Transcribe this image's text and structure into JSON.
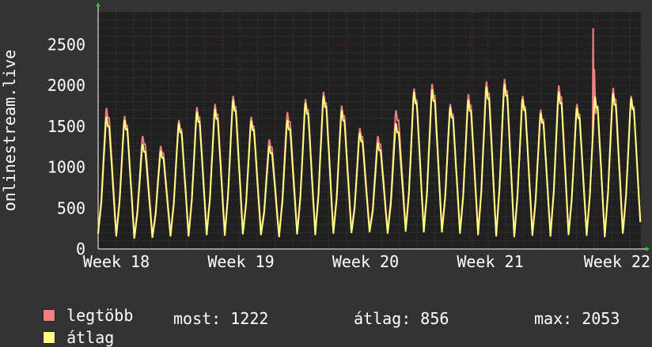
{
  "chart_data": {
    "type": "line",
    "ylabel": "onlinestream.live",
    "xtick_labels": [
      "Week 18",
      "Week 19",
      "Week 20",
      "Week 21",
      "Week 22"
    ],
    "ytick_labels": [
      "0",
      "500",
      "1000",
      "1500",
      "2000",
      "2500"
    ],
    "ylim": [
      0,
      2900
    ],
    "grid": true,
    "daily_peak_max": [
      1750,
      1650,
      1400,
      1280,
      1600,
      1760,
      1800,
      1900,
      1640,
      1360,
      1700,
      1860,
      1950,
      1780,
      1500,
      1400,
      1720,
      1990,
      2050,
      1800,
      1920,
      2080,
      2110,
      1900,
      1730,
      2030,
      1800,
      1910,
      2000,
      1900
    ],
    "daily_peak_avg": [
      1640,
      1600,
      1300,
      1220,
      1560,
      1700,
      1740,
      1850,
      1590,
      1280,
      1600,
      1810,
      1900,
      1720,
      1440,
      1320,
      1560,
      1950,
      1980,
      1760,
      1850,
      2010,
      2050,
      1860,
      1690,
      1950,
      1750,
      1890,
      1930,
      1870
    ],
    "daily_low": [
      220,
      180,
      150,
      160,
      180,
      180,
      200,
      190,
      210,
      200,
      170,
      210,
      200,
      220,
      230,
      240,
      220,
      250,
      240,
      240,
      220,
      200,
      180,
      170,
      190,
      180,
      200,
      190,
      170,
      220
    ],
    "spike_max": 2700,
    "series": [
      {
        "name": "legtöbb",
        "color": "#F08080"
      },
      {
        "name": "átlag",
        "color": "#FFFF80"
      }
    ]
  },
  "legend": {
    "max_label": "legtöbb",
    "avg_label": "átlag",
    "stat_now": "most: 1222",
    "stat_avg": "átlag: 856",
    "stat_max": "max: 2053"
  },
  "colors": {
    "background": "#333333",
    "plot_bg": "#202020",
    "max_color": "#F08080",
    "avg_color": "#FFFF80"
  }
}
